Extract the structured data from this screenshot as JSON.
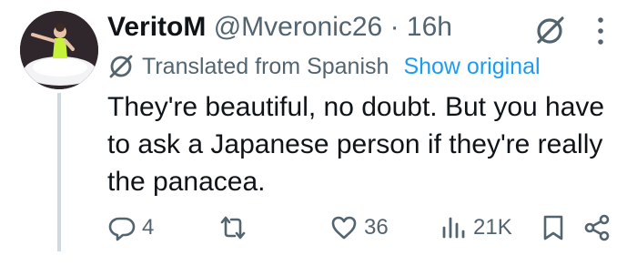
{
  "tweet": {
    "author_name": "VeritoM",
    "handle": "@Mveronic26",
    "separator": "·",
    "time": "16h",
    "translated_label": "Translated from Spanish",
    "show_original_label": "Show original",
    "text": "They're beautiful, no doubt. But you have to ask a Japanese person if they're really the panacea."
  },
  "actions": {
    "replies": "4",
    "retweets": "",
    "likes": "36",
    "views": "21K"
  },
  "icons": {
    "grok": "grok-icon",
    "more": "more-icon",
    "translate": "translate-icon",
    "reply": "reply-icon",
    "retweet": "retweet-icon",
    "like": "heart-icon",
    "views": "views-icon",
    "bookmark": "bookmark-icon",
    "share": "share-icon"
  },
  "colors": {
    "text": "#0f1419",
    "secondary": "#536471",
    "link": "#1d9bf0",
    "thread_line": "#cfd9de"
  }
}
